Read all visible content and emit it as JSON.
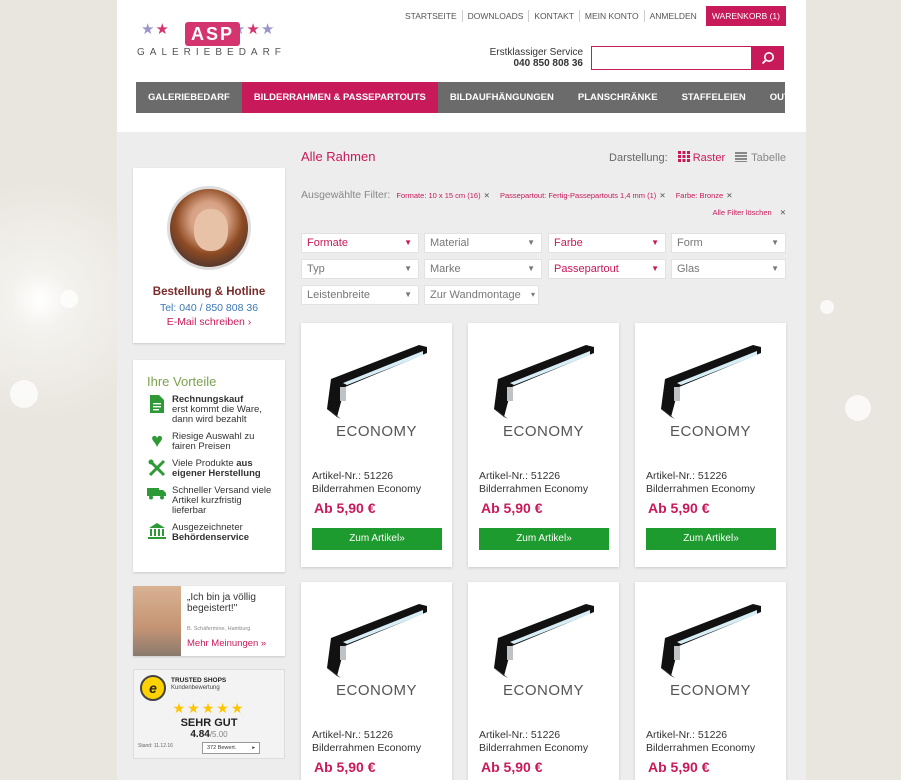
{
  "brand": {
    "logo_badge": "ASP",
    "logo_text": "GALERIEBEDARF"
  },
  "topnav": {
    "items": [
      "STARTSEITE",
      "DOWNLOADS",
      "KONTAKT",
      "MEIN KONTO",
      "ANMELDEN"
    ],
    "cart": "WARENKORB (1)"
  },
  "service": {
    "label": "Erstklassiger Service",
    "phone": "040 850 808 36"
  },
  "search": {
    "placeholder": "",
    "icon": "search-icon"
  },
  "mainnav": {
    "items": [
      "GALERIEBEDARF",
      "BILDERRAHMEN & PASSEPARTOUTS",
      "BILDAUFHÄNGUNGEN",
      "PLANSCHRÄNKE",
      "STAFFELEIEN",
      "OUTLET"
    ],
    "active_index": 1
  },
  "hotline": {
    "title": "Bestellung & Hotline",
    "tel": "Tel: 040 / 850 808 36",
    "mail": "E-Mail schreiben ›"
  },
  "vorteile": {
    "title": "Ihre Vorteile",
    "items": [
      {
        "icon": "document-icon",
        "bold": "Rechnungskauf",
        "text": "erst kommt die Ware, dann wird bezahlt"
      },
      {
        "icon": "heart-icon",
        "bold": "",
        "text": "Riesige Auswahl zu fairen Preisen"
      },
      {
        "icon": "tools-icon",
        "bold": "aus eigener Herstellung",
        "text": "Viele Produkte"
      },
      {
        "icon": "truck-icon",
        "bold": "",
        "text": "Schneller Versand viele Artikel kurzfristig lieferbar"
      },
      {
        "icon": "building-icon",
        "bold": "Behördenservice",
        "text": "Ausgezeichneter"
      }
    ]
  },
  "testimonial": {
    "quote": "„Ich bin ja völlig begeistert!\"",
    "source": "B. Schäfermine, Hamburg",
    "more": "Mehr Meinungen »"
  },
  "trusted": {
    "name": "TRUSTED SHOPS",
    "sub": "Kundenbewertung",
    "stars": "★★★★★",
    "grade": "SEHR GUT",
    "score": "4.84",
    "max": "/5.00",
    "stand": "Stand: 11.12.16",
    "reviews": "372 Bewert."
  },
  "listing": {
    "title": "Alle Rahmen",
    "view_label": "Darstellung:",
    "view_raster": "Raster",
    "view_tabelle": "Tabelle",
    "filters_label": "Ausgewählte Filter:",
    "filters": [
      "Formate: 10 x 15 cm (16)",
      "Passepartout: Fertig-Passepartouts 1,4 mm (1)",
      "Farbe: Bronze"
    ],
    "clear_all": "Alle Filter löschen",
    "selects": [
      {
        "label": "Formate",
        "active": true
      },
      {
        "label": "Material",
        "active": false
      },
      {
        "label": "Farbe",
        "active": true
      },
      {
        "label": "Form",
        "active": false
      },
      {
        "label": "Typ",
        "active": false
      },
      {
        "label": "Marke",
        "active": false
      },
      {
        "label": "Passepartout",
        "active": true
      },
      {
        "label": "Glas",
        "active": false
      },
      {
        "label": "Leistenbreite",
        "active": false
      },
      {
        "label": "Zur Wandmontage",
        "active": false
      }
    ]
  },
  "products": [
    {
      "brand": "ECONOMY",
      "artnr": "Artikel-Nr.: 51226",
      "name": "Bilderrahmen Economy",
      "price": "Ab 5,90 €",
      "button": "Zum Artikel»"
    },
    {
      "brand": "ECONOMY",
      "artnr": "Artikel-Nr.: 51226",
      "name": "Bilderrahmen Economy",
      "price": "Ab 5,90 €",
      "button": "Zum Artikel»"
    },
    {
      "brand": "ECONOMY",
      "artnr": "Artikel-Nr.: 51226",
      "name": "Bilderrahmen Economy",
      "price": "Ab 5,90 €",
      "button": "Zum Artikel»"
    },
    {
      "brand": "ECONOMY",
      "artnr": "Artikel-Nr.: 51226",
      "name": "Bilderrahmen Economy",
      "price": "Ab 5,90 €"
    },
    {
      "brand": "ECONOMY",
      "artnr": "Artikel-Nr.: 51226",
      "name": "Bilderrahmen Economy",
      "price": "Ab 5,90 €"
    },
    {
      "brand": "ECONOMY",
      "artnr": "Artikel-Nr.: 51226",
      "name": "Bilderrahmen Economy",
      "price": "Ab 5,90 €"
    }
  ],
  "colors": {
    "accent": "#c8195a",
    "nav": "#6b6b6b",
    "button": "#1e9b2e",
    "vorteile_title": "#7ca24f"
  }
}
